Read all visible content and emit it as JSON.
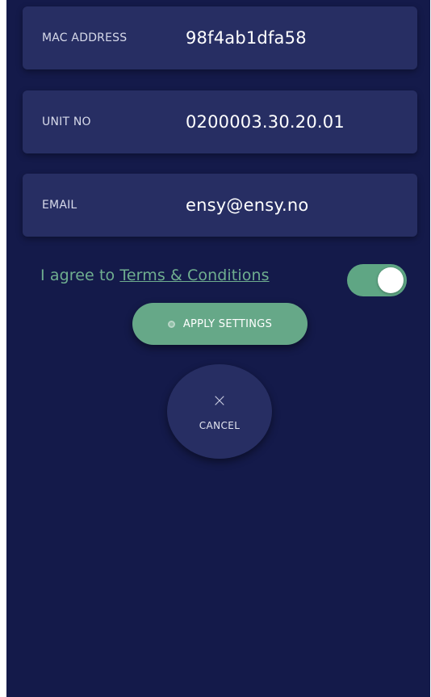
{
  "fields": [
    {
      "label": "MAC ADDRESS",
      "value": "98f4ab1dfa58"
    },
    {
      "label": "UNIT NO",
      "value": "0200003.30.20.01"
    },
    {
      "label": "EMAIL",
      "value": "ensy@ensy.no"
    }
  ],
  "terms": {
    "prefix": "I agree to ",
    "link": "Terms & Conditions",
    "toggle_on": true
  },
  "actions": {
    "apply_label": "APPLY SETTINGS",
    "cancel_label": "CANCEL",
    "cancel_icon": "×"
  },
  "colors": {
    "background": "#141a4a",
    "card": "#272e63",
    "accent": "#66a888"
  }
}
